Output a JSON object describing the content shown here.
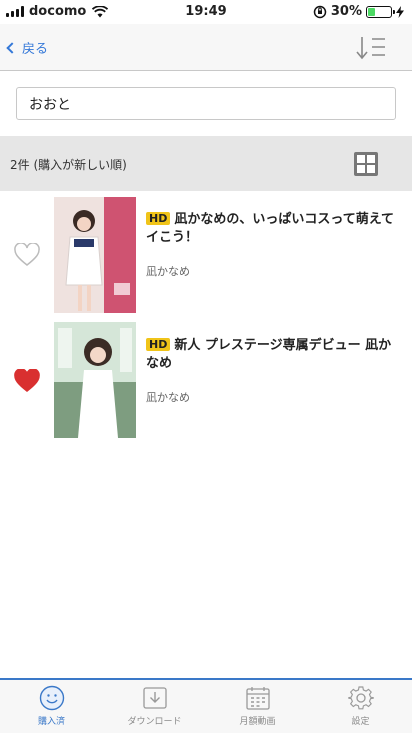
{
  "status_bar": {
    "carrier": "docomo",
    "time": "19:49",
    "battery": "30%",
    "battery_level": 0.3
  },
  "nav": {
    "back_label": "戻る"
  },
  "search": {
    "value": "おおと"
  },
  "results": {
    "count_label": "2件 (購入が新しい順)"
  },
  "items": [
    {
      "badge": "HD",
      "title": "凪かなめの、いっぱいコスって萌えてイこう！",
      "actress": "凪かなめ",
      "favorited": false,
      "cover_colors": [
        "#f2e4e2",
        "#c93a5e"
      ]
    },
    {
      "badge": "HD",
      "title": "新人 プレステージ専属デビュー 凪かなめ",
      "actress": "凪かなめ",
      "favorited": true,
      "cover_colors": [
        "#cfe3d6",
        "#6d8f74"
      ]
    }
  ],
  "tabs": [
    {
      "label": "購入済",
      "icon": "smile-icon",
      "active": true
    },
    {
      "label": "ダウンロード",
      "icon": "download-icon",
      "active": false
    },
    {
      "label": "月額動画",
      "icon": "calendar-icon",
      "active": false
    },
    {
      "label": "設定",
      "icon": "gear-icon",
      "active": false
    }
  ],
  "colors": {
    "accent": "#3478d8",
    "heart_active": "#d93030",
    "hd_badge": "#f0c419"
  }
}
